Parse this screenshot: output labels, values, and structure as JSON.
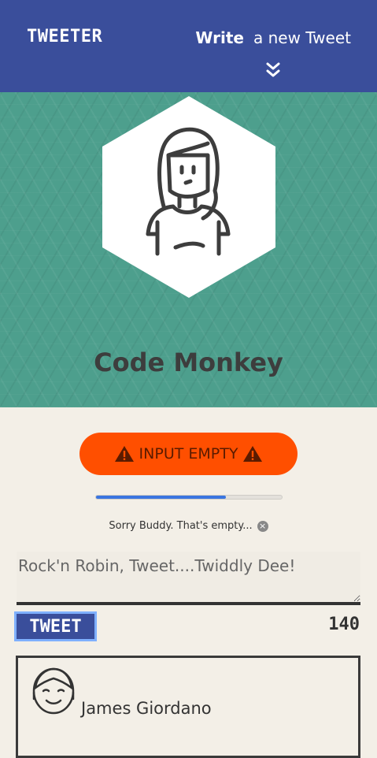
{
  "nav": {
    "brand": "TWEETER",
    "compose_bold": "Write",
    "compose_rest": "a new Tweet"
  },
  "profile": {
    "name": "Code Monkey"
  },
  "alert": {
    "label": "INPUT EMPTY",
    "color": "#ff4f00"
  },
  "progress": {
    "fraction": 0.7
  },
  "error": {
    "message": "Sorry Buddy. That's empty..."
  },
  "composer": {
    "placeholder": "Rock'n Robin, Tweet....Twiddly Dee!",
    "value": "",
    "button_label": "TWEET",
    "remaining": "140"
  },
  "tweet": {
    "author": "James Giordano"
  },
  "colors": {
    "nav": "#3a4e9b",
    "hero": "#4d9f8d",
    "background": "#f3efe7"
  }
}
